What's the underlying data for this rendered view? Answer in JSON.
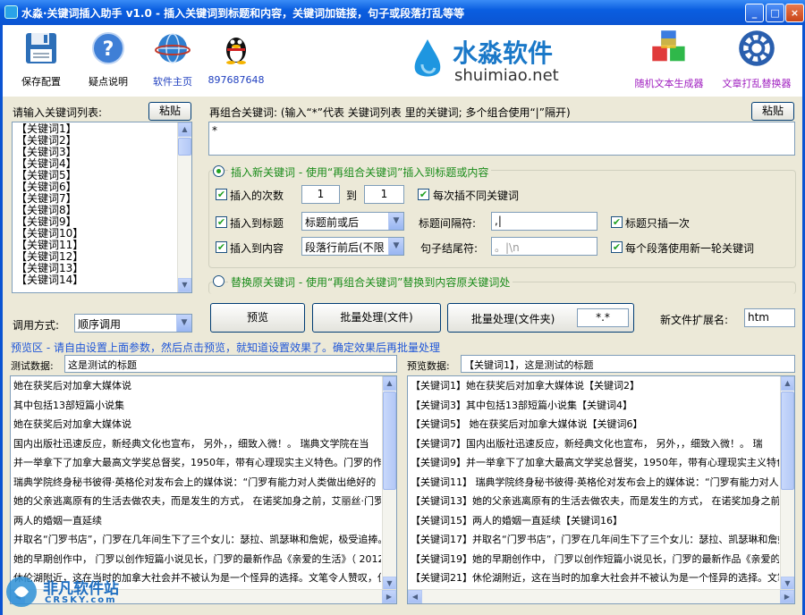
{
  "window": {
    "title": "水淼·关键词插入助手 v1.0 - 插入关键词到标题和内容，关键词加链接，句子或段落打乱等等",
    "minimize": "_",
    "maximize": "□",
    "close": "×"
  },
  "toolbar": {
    "save": "保存配置",
    "help": "疑点说明",
    "home": "软件主页",
    "qq": "897687648",
    "random_text": "随机文本生成器",
    "article_shuffle": "文章打乱替换器"
  },
  "logo": {
    "name": "水淼软件",
    "domain": "shuimiao.net"
  },
  "keywords": {
    "label": "请输入关键词列表:",
    "paste": "粘贴",
    "items": [
      "【关键词1】",
      "【关键词2】",
      "【关键词3】",
      "【关键词4】",
      "【关键词5】",
      "【关键词6】",
      "【关键词7】",
      "【关键词8】",
      "【关键词9】",
      "【关键词10】",
      "【关键词11】",
      "【关键词12】",
      "【关键词13】",
      "【关键词14】"
    ]
  },
  "recombine": {
    "label": "再组合关键词: (输入“*”代表 关键词列表 里的关键词; 多个组合使用“|”隔开)",
    "paste": "粘贴",
    "value": "*"
  },
  "insert_section": {
    "title": "插入新关键词 - 使用“再组合关键词”插入到标题或内容",
    "times_label": "插入的次数",
    "times_from": "1",
    "to_label": "到",
    "times_to": "1",
    "diff_each": "每次插不同关键词",
    "to_title": "插入到标题",
    "title_mode": "标题前或后",
    "title_sep_label": "标题间隔符:",
    "title_sep": ",|",
    "title_once": "标题只插一次",
    "to_content": "插入到内容",
    "content_mode": "段落行前后(不限",
    "sentence_end_label": "句子结尾符:",
    "sentence_end": "。|\\n",
    "new_round": "每个段落使用新一轮关键词"
  },
  "replace_section": {
    "title": "替换原关键词 - 使用“再组合关键词”替换到内容原关键词处"
  },
  "call_mode": {
    "label": "调用方式:",
    "value": "顺序调用"
  },
  "actions": {
    "preview": "预览",
    "batch_file": "批量处理(文件)",
    "batch_folder": "批量处理(文件夹)",
    "pattern": "*.*",
    "ext_label": "新文件扩展名:",
    "ext_value": "htm"
  },
  "preview_hint": "预览区 - 请自由设置上面参数，然后点击预览，就知道设置效果了。确定效果后再批量处理",
  "test": {
    "label": "测试数据:",
    "title": "这是测试的标题",
    "lines": [
      "她在获奖后对加拿大媒体说",
      "其中包括13部短篇小说集",
      "  她在获奖后对加拿大媒体说",
      "国内出版社迅速反应，新经典文化也宣布，   另外，，细致入微！。   瑞典文学院在当",
      "并一举拿下了加拿大最高文学奖总督奖，1950年，带有心理现实主义特色。门罗的作品以",
      "  瑞典学院终身秘书彼得·英格伦对发布会上的媒体说：“门罗有能力对人类做出绝好的",
      "她的父亲逃离原有的生活去做农夫，而是发生的方式，   在诺奖加身之前，艾丽丝·门罗",
      "两人的婚姻一直延续",
      "并取名“门罗书店”，门罗在几年间生下了三个女儿：瑟拉、凯瑟琳和詹妮，极受追捧。",
      "她的早期创作中，  门罗以创作短篇小说见长，门罗的最新作品《亲爱的生活》（ 2012年",
      "休伦湖附近，这在当时的加拿大社会并不被认为是一个怪异的选择。文笔令人赞叹，但她"
    ]
  },
  "preview": {
    "label": "预览数据:",
    "title": "【关键词1】，这是测试的标题",
    "lines": [
      "【关键词1】她在获奖后对加拿大媒体说【关键词2】",
      "【关键词3】其中包括13部短篇小说集【关键词4】",
      "【关键词5】  她在获奖后对加拿大媒体说【关键词6】",
      "【关键词7】国内出版社迅速反应，新经典文化也宣布，   另外，，细致入微！。   瑞",
      "【关键词9】并一举拿下了加拿大最高文学奖总督奖，1950年，带有心理现实主义特色。",
      "【关键词11】  瑞典学院终身秘书彼得·英格伦对发布会上的媒体说：“门罗有能力对人",
      "【关键词13】她的父亲逃离原有的生活去做农夫，而是发生的方式，   在诺奖加身之前",
      "【关键词15】两人的婚姻一直延续【关键词16】",
      "【关键词17】并取名“门罗书店”，门罗在几年间生下了三个女儿：瑟拉、凯瑟琳和詹妮",
      "【关键词19】她的早期创作中，  门罗以创作短篇小说见长，门罗的最新作品《亲爱的生",
      "【关键词21】休伦湖附近，这在当时的加拿大社会并不被认为是一个怪异的选择。文笔令"
    ]
  },
  "watermark": {
    "name": "非凡软件站",
    "site": "CRSKY.com"
  }
}
